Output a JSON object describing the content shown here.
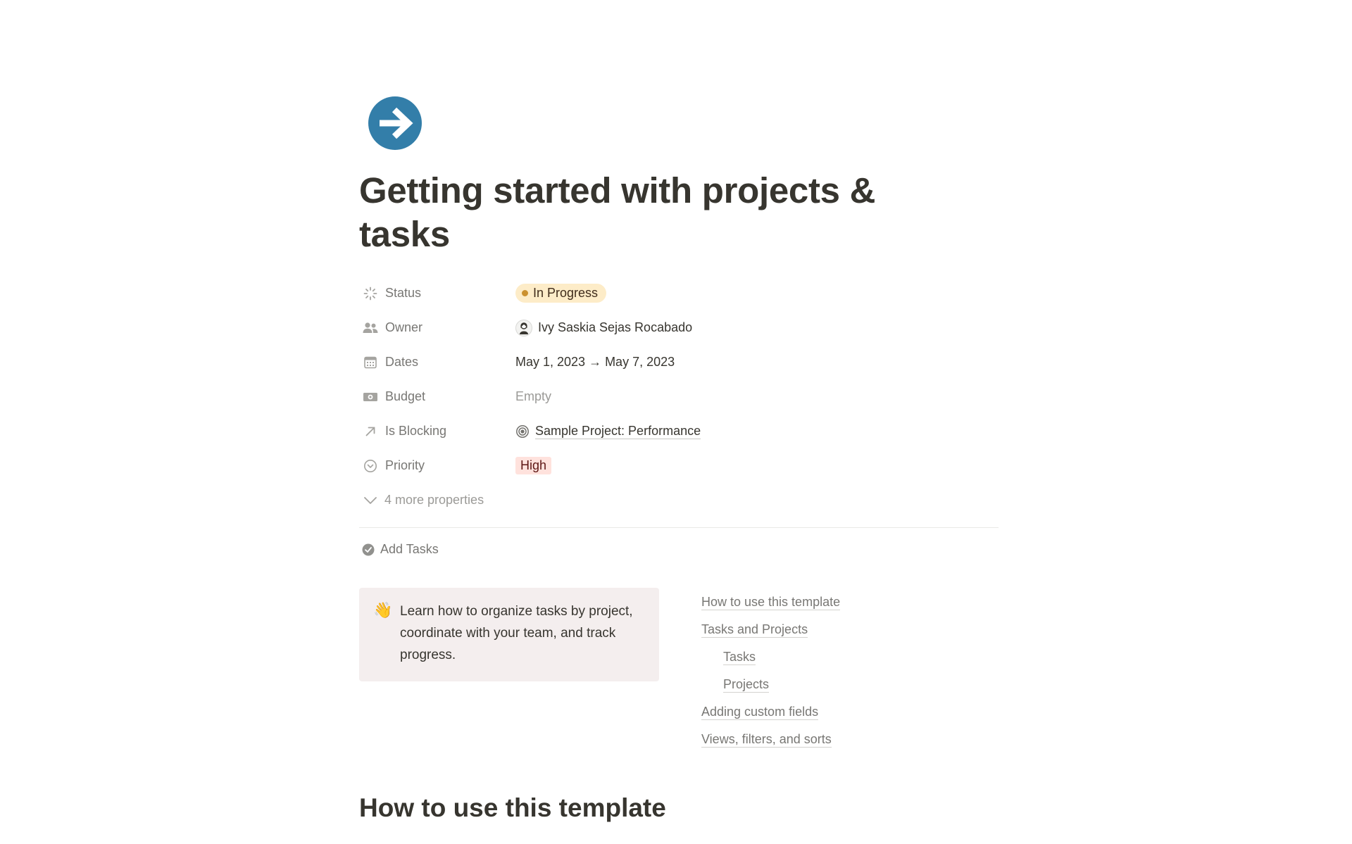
{
  "page": {
    "title": "Getting started with projects & tasks",
    "icon": "arrow-right-circle-icon",
    "icon_color": "#337ea9"
  },
  "properties": {
    "status": {
      "label": "Status",
      "icon": "status-spinner-icon",
      "value": "In Progress",
      "pill_color": "#fdecc8",
      "dot_color": "#cb912f"
    },
    "owner": {
      "label": "Owner",
      "icon": "people-icon",
      "value": "Ivy Saskia Sejas Rocabado"
    },
    "dates": {
      "label": "Dates",
      "icon": "calendar-icon",
      "value": "May 1, 2023 → May 7, 2023"
    },
    "budget": {
      "label": "Budget",
      "icon": "money-icon",
      "value": "Empty"
    },
    "is_blocking": {
      "label": "Is Blocking",
      "icon": "arrow-up-right-icon",
      "value": "Sample Project: Performance"
    },
    "priority": {
      "label": "Priority",
      "icon": "priority-chevron-icon",
      "value": "High",
      "pill_color": "#ffe2dd"
    },
    "more": "4 more properties"
  },
  "actions": {
    "add_tasks": "Add Tasks"
  },
  "callout": {
    "emoji": "👋",
    "text": "Learn how to organize tasks by project, coordinate with your team, and track progress."
  },
  "toc": [
    {
      "label": "How to use this template",
      "indent": 0
    },
    {
      "label": "Tasks and Projects",
      "indent": 0
    },
    {
      "label": "Tasks",
      "indent": 1
    },
    {
      "label": "Projects",
      "indent": 1
    },
    {
      "label": "Adding custom fields",
      "indent": 0
    },
    {
      "label": "Views, filters, and sorts",
      "indent": 0
    }
  ],
  "section": {
    "heading": "How to use this template"
  }
}
